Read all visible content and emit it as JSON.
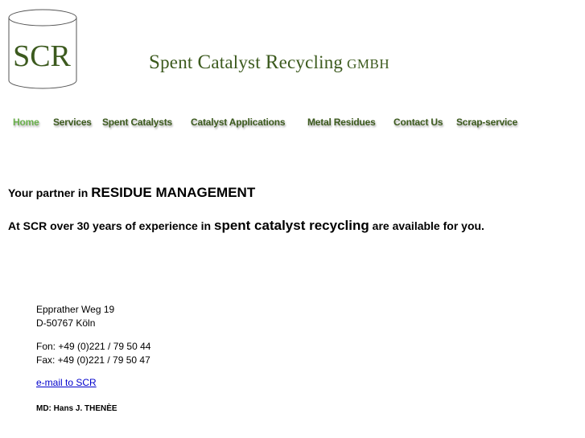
{
  "header": {
    "logo_text": "SCR",
    "company": {
      "s": "S",
      "pent": "pent ",
      "c": "C",
      "atalyst": "atalyst ",
      "r": "R",
      "ecycling": "ecycling",
      "suffix": "GMBH"
    }
  },
  "nav": {
    "items": [
      {
        "label": "Home"
      },
      {
        "label": "Services"
      },
      {
        "label": "Spent Catalysts"
      },
      {
        "label": "Catalyst Applications"
      },
      {
        "label": "Metal Residues"
      },
      {
        "label": "Contact Us"
      },
      {
        "label": "Scrap-service"
      }
    ]
  },
  "main": {
    "tagline_prefix": "Your partner in ",
    "tagline_emphasis": "RESIDUE MANAGEMENT",
    "intro_prefix": "At SCR over 30 years of experience in ",
    "intro_emphasis": "spent catalyst recycling",
    "intro_suffix": " are available for you."
  },
  "contact": {
    "street": "Epprather Weg 19",
    "city": "D-50767 Köln",
    "phone": "Fon: +49 (0)221 / 79 50 44",
    "fax": "Fax: +49 (0)221 / 79 50 47",
    "email_label": "e-mail to SCR",
    "md": "MD: Hans J. THENÈE"
  },
  "colors": {
    "brand_green": "#3c5a1e",
    "nav_active": "#6ab04c",
    "link_blue": "#0000cc"
  }
}
